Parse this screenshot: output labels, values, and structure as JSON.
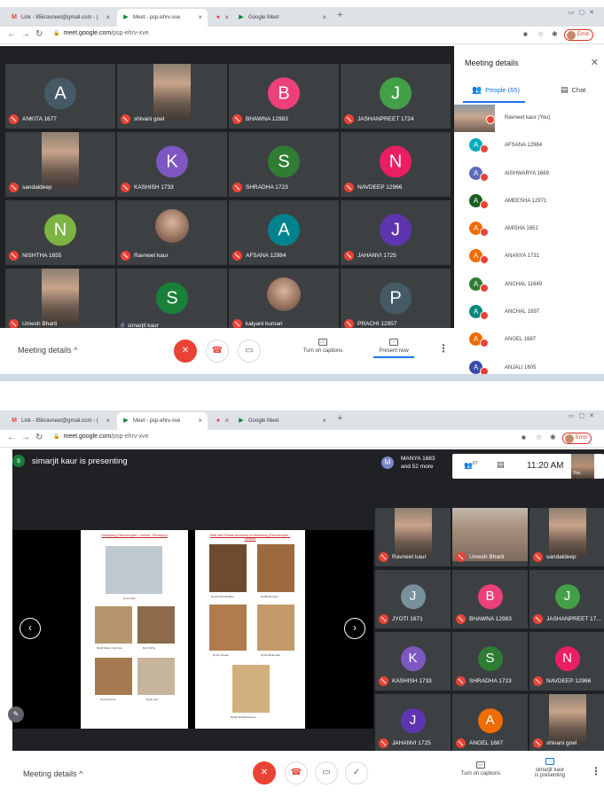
{
  "colors": {
    "meet_bg": "#202124",
    "tile_bg": "#3c4043",
    "mic_off": "#ea4335",
    "accent_blue": "#1a73e8"
  },
  "browser": {
    "tabs": [
      {
        "icon": "gmail-icon",
        "label": "Link - 85kravneet@gmail.com - ("
      },
      {
        "icon": "meet-icon",
        "label": "Meet - psp-ehrv-xve"
      },
      {
        "icon": "recording-icon",
        "label": ""
      },
      {
        "icon": "meet-icon",
        "label": "Google Meet"
      }
    ],
    "url_host": "meet.google.com",
    "url_path": "/psp-ehrv-xve",
    "profile_label": "Error"
  },
  "shot1": {
    "tiles": [
      {
        "name": "ANKITA 1677",
        "initial": "A",
        "color": "#455a64",
        "kind": "avatar"
      },
      {
        "name": "shivani goel",
        "kind": "photo"
      },
      {
        "name": "BHAWNA 12983",
        "initial": "B",
        "color": "#ec407a",
        "kind": "avatar"
      },
      {
        "name": "JASHANPREET 1724",
        "initial": "J",
        "color": "#43a047",
        "kind": "avatar"
      },
      {
        "name": "sandaldeep",
        "kind": "photo"
      },
      {
        "name": "KASHISH 1733",
        "initial": "K",
        "color": "#7e57c2",
        "kind": "avatar"
      },
      {
        "name": "SHRADHA 1723",
        "initial": "S",
        "color": "#2e7d32",
        "kind": "avatar"
      },
      {
        "name": "NAVDEEP 12966",
        "initial": "N",
        "color": "#e91e63",
        "kind": "avatar"
      },
      {
        "name": "NISHTHA 1655",
        "initial": "N",
        "color": "#7cb342",
        "kind": "avatar"
      },
      {
        "name": "Ravneet kaur",
        "kind": "round"
      },
      {
        "name": "AFSANA 12984",
        "initial": "A",
        "color": "#00838f",
        "kind": "avatar"
      },
      {
        "name": "JAHANVI 1725",
        "initial": "J",
        "color": "#5e35b1",
        "kind": "avatar"
      },
      {
        "name": "Umesh Bharti",
        "kind": "photo"
      },
      {
        "name": "simarjit kaur",
        "initial": "S",
        "color": "#188038",
        "kind": "avatar",
        "speaking": true
      },
      {
        "name": "kalyani kumari",
        "kind": "round"
      },
      {
        "name": "PRACHI 12957",
        "initial": "P",
        "color": "#455a64",
        "kind": "avatar"
      }
    ],
    "bottom": {
      "meeting_details": "Meeting details",
      "captions_label": "Turn on captions",
      "present_label": "Present now"
    },
    "panel": {
      "title": "Meeting details",
      "people_tab": "People (65)",
      "chat_tab": "Chat",
      "people": [
        {
          "name": "Ravneet kaur (You)",
          "initial": "",
          "color": "#000000",
          "self": true
        },
        {
          "name": "AFSANA 12984",
          "initial": "A",
          "color": "#00acc1"
        },
        {
          "name": "AISHWARYA 1669",
          "initial": "A",
          "color": "#5c6bc0"
        },
        {
          "name": "AMEESHA 12971",
          "initial": "A",
          "color": "#1b5e20"
        },
        {
          "name": "AMISHA 1651",
          "initial": "A",
          "color": "#ef6c00"
        },
        {
          "name": "ANANYA 1731",
          "initial": "A",
          "color": "#ef6c00"
        },
        {
          "name": "ANCHAL 11649",
          "initial": "A",
          "color": "#2e7d32"
        },
        {
          "name": "ANCHAL 1697",
          "initial": "A",
          "color": "#00897b"
        },
        {
          "name": "ANGEL 1687",
          "initial": "A",
          "color": "#ef6c00"
        },
        {
          "name": "ANJALI 1605",
          "initial": "A",
          "color": "#3949ab"
        }
      ]
    }
  },
  "shot2": {
    "presenter_initial": "s",
    "presenter_text": "simarjit kaur is presenting",
    "top_info": {
      "initial": "M",
      "line1": "MANYA 1683",
      "line2": "and 52 more"
    },
    "people_count": "67",
    "clock": "11:20 AM",
    "you_label": "You",
    "slide": {
      "left_title": "Harvesting (Parsonocytes - Lecture: Thesaurus)",
      "right_title": "Male and Female structures of Harvesting (Parsonocytes - Lecture)",
      "left_captions": [
        "Fig 1A Adult",
        "Fig 1B Tarsus / Front view",
        "Fig 1C Wing",
        "Fig 1D Antenna",
        "Fig 1E Leaf"
      ],
      "right_captions": [
        "Fig 2A Head Mandibles",
        "Fig 2B Tarsomere",
        "Fig 2C Ommata",
        "Fig 2D Tarsal Claws",
        "Fig 2E Tarsal Membranes"
      ]
    },
    "tiles": [
      {
        "name": "Ravneet kaur",
        "kind": "photo"
      },
      {
        "name": "Umesh Bharti",
        "kind": "wide"
      },
      {
        "name": "sandaldeep",
        "kind": "photo"
      },
      {
        "name": "JYOTI 1671",
        "initial": "J",
        "color": "#78909c",
        "kind": "avatar"
      },
      {
        "name": "BHAWNA 12983",
        "initial": "B",
        "color": "#ec407a",
        "kind": "avatar"
      },
      {
        "name": "JASHANPREET 17...",
        "initial": "J",
        "color": "#43a047",
        "kind": "avatar"
      },
      {
        "name": "KASHISH 1733",
        "initial": "K",
        "color": "#7e57c2",
        "kind": "avatar"
      },
      {
        "name": "SHRADHA 1723",
        "initial": "S",
        "color": "#2e7d32",
        "kind": "avatar"
      },
      {
        "name": "NAVDEEP 12966",
        "initial": "N",
        "color": "#e91e63",
        "kind": "avatar"
      },
      {
        "name": "JAHANVI 1725",
        "initial": "J",
        "color": "#5e35b1",
        "kind": "avatar"
      },
      {
        "name": "ANGEL 1687",
        "initial": "A",
        "color": "#ef6c00",
        "kind": "avatar"
      },
      {
        "name": "shivani goel",
        "kind": "photo"
      }
    ],
    "bottom": {
      "meeting_details": "Meeting details",
      "captions_label": "Turn on captions",
      "presenting_line1": "simarjit kaur",
      "presenting_line2": "is presenting"
    }
  }
}
